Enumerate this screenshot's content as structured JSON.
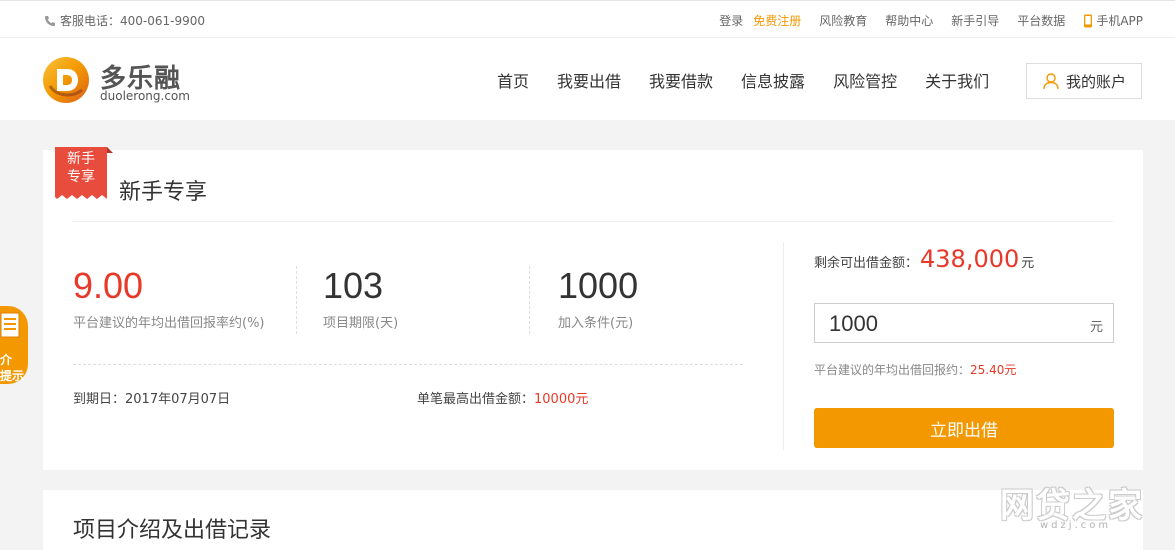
{
  "topbar": {
    "phone": "客服电话：400-061-9900",
    "links": {
      "login": "登录",
      "register": "免费注册",
      "risk_edu": "风险教育",
      "help": "帮助中心",
      "guide": "新手引导",
      "data": "平台数据",
      "app": "手机APP"
    }
  },
  "header": {
    "brand": "多乐融",
    "domain": "duolerong.com",
    "nav": [
      "首页",
      "我要出借",
      "我要借款",
      "信息披露",
      "风险管控",
      "关于我们"
    ],
    "account": "我的账户"
  },
  "product": {
    "ribbon_line1": "新手",
    "ribbon_line2": "专享",
    "title": "新手专享",
    "rate": "9.00",
    "rate_label": "平台建议的年均出借回报率约(%)",
    "term": "103",
    "term_label": "项目期限(天)",
    "min": "1000",
    "min_label": "加入条件(元)",
    "due_label": "到期日：",
    "due_date": "2017年07月07日",
    "max_label": "单笔最高出借金额：",
    "max_value": "10000元"
  },
  "invest": {
    "remain_label": "剩余可出借金额：",
    "remain_value": "438,000",
    "remain_unit": "元",
    "amount": "1000",
    "amount_unit": "元",
    "expected_label": "平台建议的年均出借回报约：",
    "expected_value": "25.40元",
    "button": "立即出借"
  },
  "section2": {
    "title": "项目介绍及出借记录"
  },
  "float_widget": {
    "line1": "介",
    "line2": "提示"
  },
  "watermark": {
    "big": "网贷之家",
    "small": "wdzj.com"
  },
  "colors": {
    "accent": "#f39800",
    "red": "#e83828"
  }
}
